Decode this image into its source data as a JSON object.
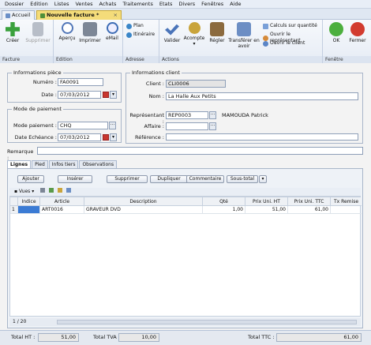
{
  "menu": [
    "Dossier",
    "Edition",
    "Listes",
    "Ventes",
    "Achats",
    "Traitements",
    "Etats",
    "Divers",
    "Fenêtres",
    "Aide"
  ],
  "tabs": {
    "home": "Accueil",
    "active": "Nouvelle facture *",
    "close": "×"
  },
  "ribbon": {
    "facture": {
      "label": "Facture",
      "create": "Créer",
      "delete": "Supprimer"
    },
    "edition": {
      "label": "Edition",
      "preview": "Aperçu",
      "print": "Imprimer",
      "email": "eMail"
    },
    "adresse": {
      "label": "Adresse",
      "plan": "Plan",
      "itinerary": "Itinéraire"
    },
    "actions": {
      "label": "Actions",
      "validate": "Valider",
      "deposit": "Acompte",
      "pay": "Régler",
      "transfer": "Transférer en avoir",
      "calc": "Calculs sur quantité",
      "open_rep": "Ouvrir le représentant",
      "open_client": "Ouvrir le client"
    },
    "fenetre": {
      "label": "Fenêtre",
      "ok": "OK",
      "close": "Fermer"
    }
  },
  "piece": {
    "title": "Informations pièce",
    "number_label": "Numéro :",
    "number": "FA0091",
    "date_label": "Date :",
    "date": "07/03/2012"
  },
  "client": {
    "title": "Informations client",
    "client_label": "Client :",
    "client": "CLI0006",
    "name_label": "Nom :",
    "name": "La Halle Aux Petits",
    "rep_label": "Représentant :",
    "rep": "REP0003",
    "rep_name": "MAMOUDA Patrick",
    "affaire_label": "Affaire :",
    "affaire": "",
    "ref_label": "Référence :",
    "ref": ""
  },
  "paiement": {
    "title": "Mode de paiement",
    "mode_label": "Mode paiement :",
    "mode": "CHQ",
    "due_label": "Date Echéance :",
    "due": "07/03/2012"
  },
  "remarque": {
    "label": "Remarque :",
    "value": ""
  },
  "subtabs": [
    "Lignes",
    "Pied",
    "Infos tiers",
    "Observations"
  ],
  "line_buttons": {
    "add": "Ajouter",
    "insert": "Insérer",
    "delete": "Supprimer",
    "duplicate": "Dupliquer",
    "comment": "Commentaire",
    "subtotal": "Sous-total"
  },
  "grid_toolbar": {
    "views": "Vues"
  },
  "grid": {
    "headers": [
      "Indice",
      "Article",
      "Description",
      "Qté",
      "Prix Uni. HT",
      "Prix Uni. TTC",
      "Tx Remise"
    ],
    "rows": [
      {
        "n": "1",
        "indice": "",
        "article": "ART0016",
        "description": "GRAVEUR DVD",
        "qty": "1,00",
        "pu_ht": "51,00",
        "pu_ttc": "61,00",
        "remise": ""
      }
    ]
  },
  "pager": "1 / 20",
  "totals": {
    "ht_label": "Total HT :",
    "ht": "51,00",
    "tva_label": "Total TVA :",
    "tva": "10,00",
    "ttc_label": "Total TTC :",
    "ttc": "61,00"
  },
  "colors": {
    "accent": "#f4dc7a",
    "ribbon_bg": "#e6ecf5",
    "selected_cell": "#3b7bd4"
  }
}
